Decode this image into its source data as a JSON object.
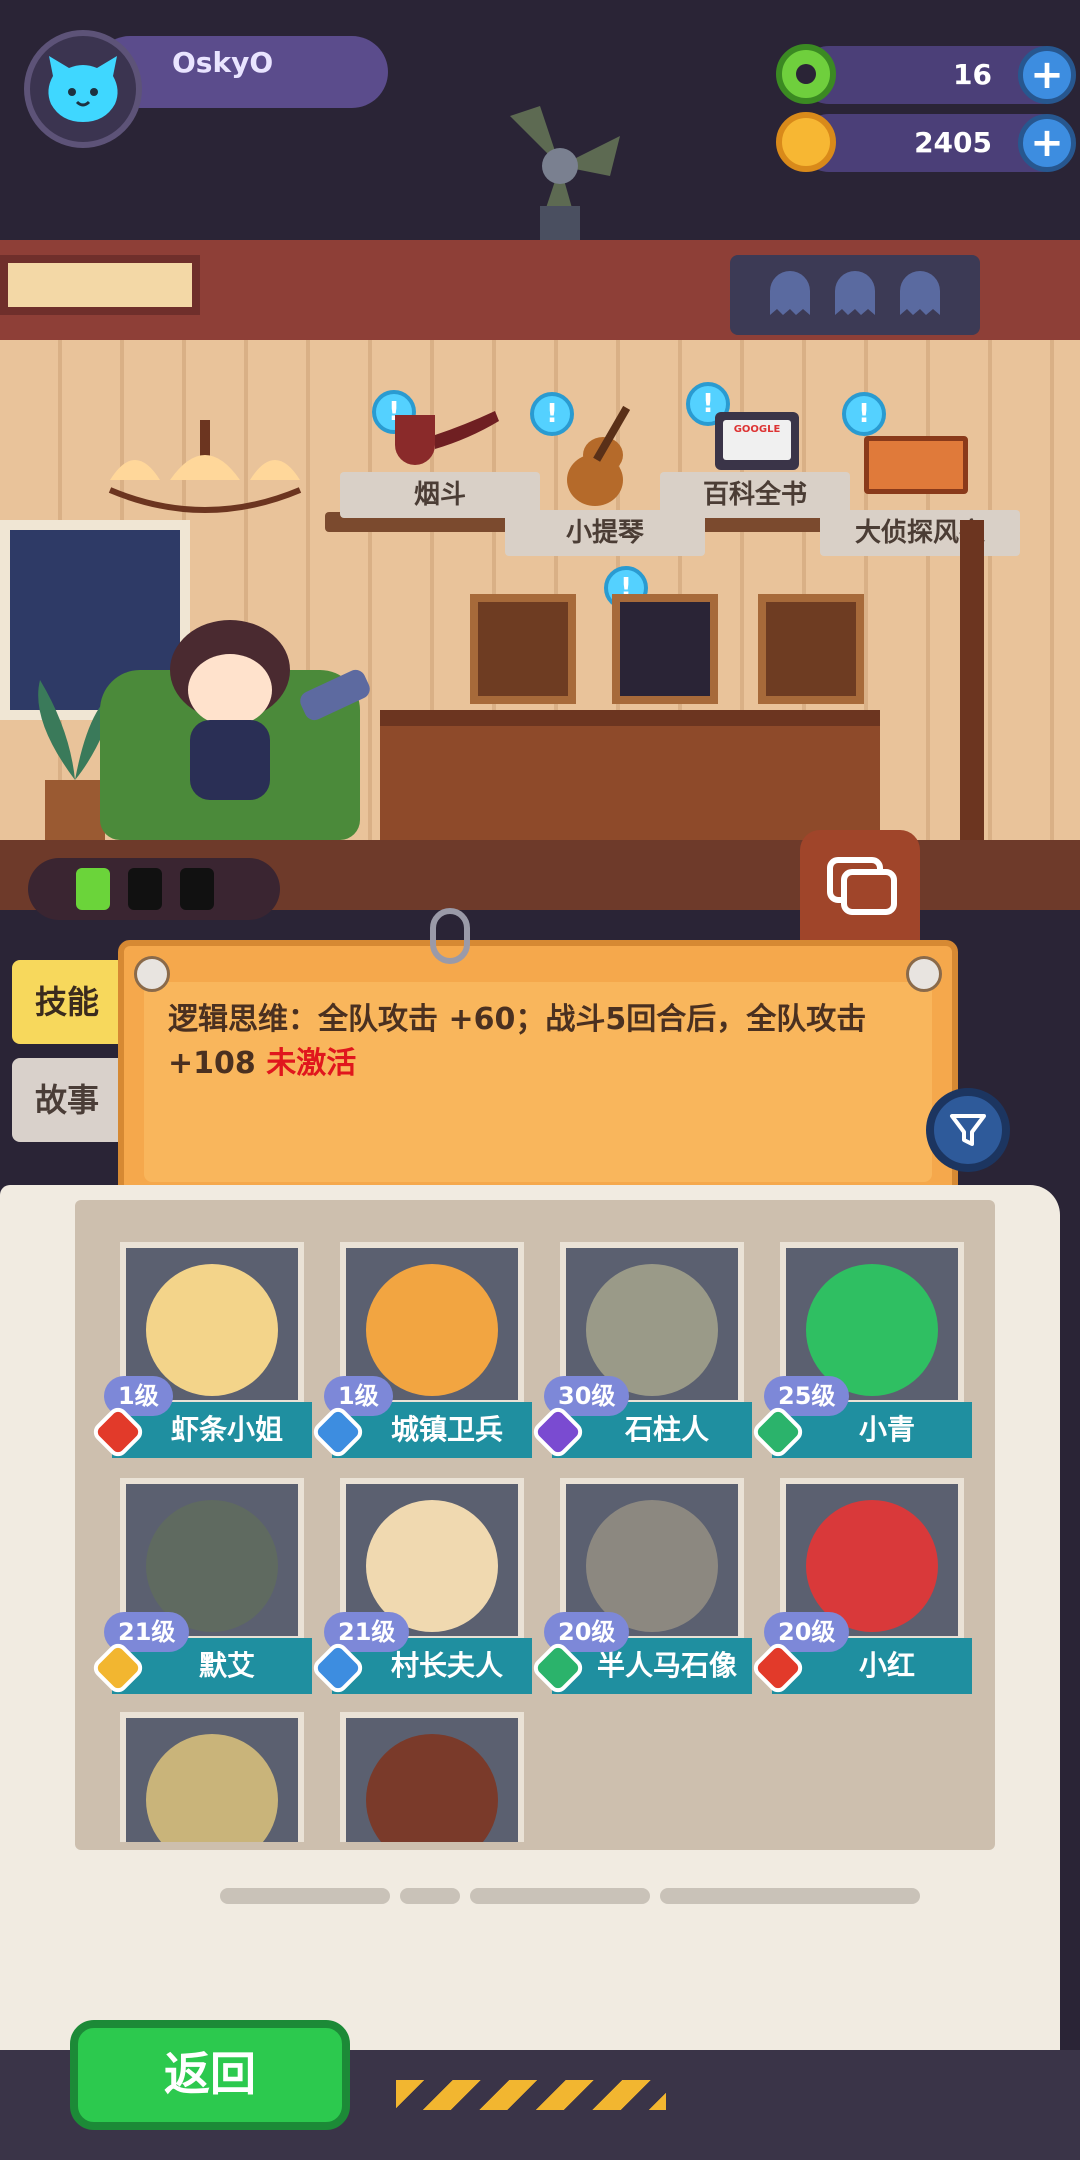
{
  "player": {
    "name": "OskyO"
  },
  "currencies": [
    {
      "name": "donut",
      "value": "16",
      "color": "#6fcf3d"
    },
    {
      "name": "coin",
      "value": "2405",
      "color": "#f7b733"
    }
  ],
  "room": {
    "items": [
      {
        "label": "烟斗"
      },
      {
        "label": "小提琴"
      },
      {
        "label": "百科全书"
      },
      {
        "label": "大侦探风衣"
      }
    ],
    "note_badge": "!",
    "book_logo": "GOOGLE"
  },
  "tabs": {
    "skill": "技能",
    "story": "故事"
  },
  "skill": {
    "text": "逻辑思维：全队攻击 +60；战斗5回合后，全队攻击 +108",
    "status": "未激活",
    "status_color": "#e0161d"
  },
  "characters": [
    {
      "level": "1级",
      "name": "虾条小姐",
      "rank_color": "#e23a2a",
      "portrait_color": "#f3d48a"
    },
    {
      "level": "1级",
      "name": "城镇卫兵",
      "rank_color": "#3d8de0",
      "portrait_color": "#f2a541"
    },
    {
      "level": "30级",
      "name": "石柱人",
      "rank_color": "#7a4bd1",
      "portrait_color": "#9a9a88"
    },
    {
      "level": "25级",
      "name": "小青",
      "rank_color": "#2bb36b",
      "portrait_color": "#2fbf62"
    },
    {
      "level": "21级",
      "name": "默艾",
      "rank_color": "#f2b630",
      "portrait_color": "#5f6a60"
    },
    {
      "level": "21级",
      "name": "村长夫人",
      "rank_color": "#3d8de0",
      "portrait_color": "#f0d9b0"
    },
    {
      "level": "20级",
      "name": "半人马石像",
      "rank_color": "#2bb36b",
      "portrait_color": "#8c8880"
    },
    {
      "level": "20级",
      "name": "小红",
      "rank_color": "#e23a2a",
      "portrait_color": "#d9393a"
    },
    {
      "level": "",
      "name": "",
      "rank_color": "",
      "portrait_color": "#c9b47a"
    },
    {
      "level": "",
      "name": "",
      "rank_color": "",
      "portrait_color": "#7a3a2a"
    }
  ],
  "bottom": {
    "back_label": "返回"
  }
}
